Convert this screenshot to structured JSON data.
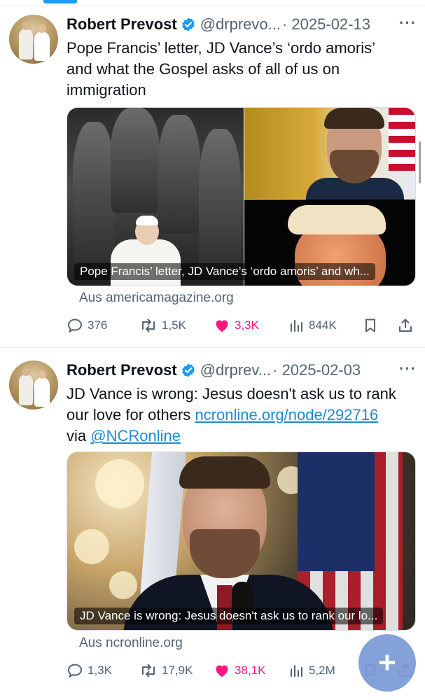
{
  "tweets": [
    {
      "name": "Robert Prevost",
      "handle": "@drprevo...",
      "date": "· 2025-02-13",
      "more": "···",
      "text_lines": [
        "Pope Francis’ letter, JD Vance’s ‘ordo amoris’",
        "and what the Gospel asks of all of us on",
        "immigration"
      ],
      "card_caption": "Pope Francis’ letter, JD Vance’s ‘ordo amoris’ and wh...",
      "source": "Aus americamagazine.org",
      "stats": {
        "replies": "376",
        "reposts": "1,5K",
        "likes": "3,3K",
        "views": "844K"
      }
    },
    {
      "name": "Robert Prevost",
      "handle": "@drprev...",
      "date": "· 2025-02-03",
      "more": "···",
      "text_line1": "JD Vance is wrong: Jesus doesn't ask us to rank",
      "text_line2_pre": "our love for others ",
      "text_link": "ncronline.org/node/292716",
      "text_line3_pre": "via ",
      "text_mention": "@NCRonline",
      "card_caption": "JD Vance is wrong: Jesus doesn't ask us to rank our lo...",
      "source": "Aus ncronline.org",
      "stats": {
        "replies": "1,3K",
        "reposts": "17,9K",
        "likes": "38,1K",
        "views": "5,2M"
      }
    }
  ],
  "icons": [
    "verified-badge-icon",
    "reply-icon",
    "repost-icon",
    "like-icon",
    "views-icon",
    "bookmark-icon",
    "share-icon",
    "compose-plus-icon"
  ],
  "colors": {
    "accent": "#1d9bf0",
    "like": "#f91880",
    "muted": "#536471",
    "link": "#1a8cd8"
  }
}
